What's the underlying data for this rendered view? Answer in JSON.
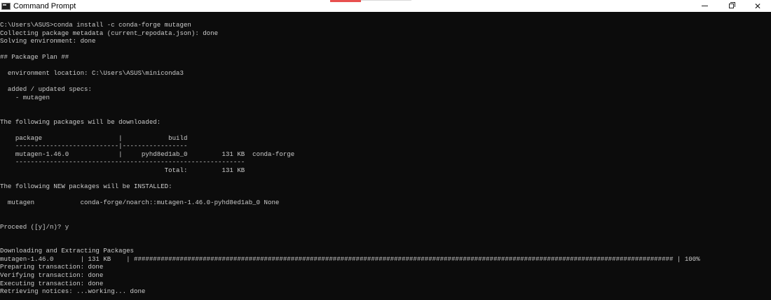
{
  "window": {
    "title": "Command Prompt",
    "icon": "cmd-icon",
    "controls": {
      "minimize": "minimize-icon",
      "maximize": "restore-icon",
      "close": "close-icon"
    }
  },
  "colors": {
    "background": "#0c0c0c",
    "text": "#cccccc",
    "titlebar": "#ffffff"
  },
  "console": {
    "lines": [
      "C:\\Users\\ASUS>conda install -c conda-forge mutagen",
      "Collecting package metadata (current_repodata.json): done",
      "Solving environment: done",
      "",
      "## Package Plan ##",
      "",
      "  environment location: C:\\Users\\ASUS\\miniconda3",
      "",
      "  added / updated specs:",
      "    - mutagen",
      "",
      "",
      "The following packages will be downloaded:",
      "",
      "    package                    |            build",
      "    ---------------------------|-----------------",
      "    mutagen-1.46.0             |     pyhd8ed1ab_0         131 KB  conda-forge",
      "    ------------------------------------------------------------",
      "                                           Total:         131 KB",
      "",
      "The following NEW packages will be INSTALLED:",
      "",
      "  mutagen            conda-forge/noarch::mutagen-1.46.0-pyhd8ed1ab_0 None",
      "",
      "",
      "Proceed ([y]/n)? y",
      "",
      "",
      "Downloading and Extracting Packages",
      "mutagen-1.46.0       | 131 KB    | ############################################################################################################################################# | 100%",
      "Preparing transaction: done",
      "Verifying transaction: done",
      "Executing transaction: done",
      "Retrieving notices: ...working... done"
    ]
  }
}
